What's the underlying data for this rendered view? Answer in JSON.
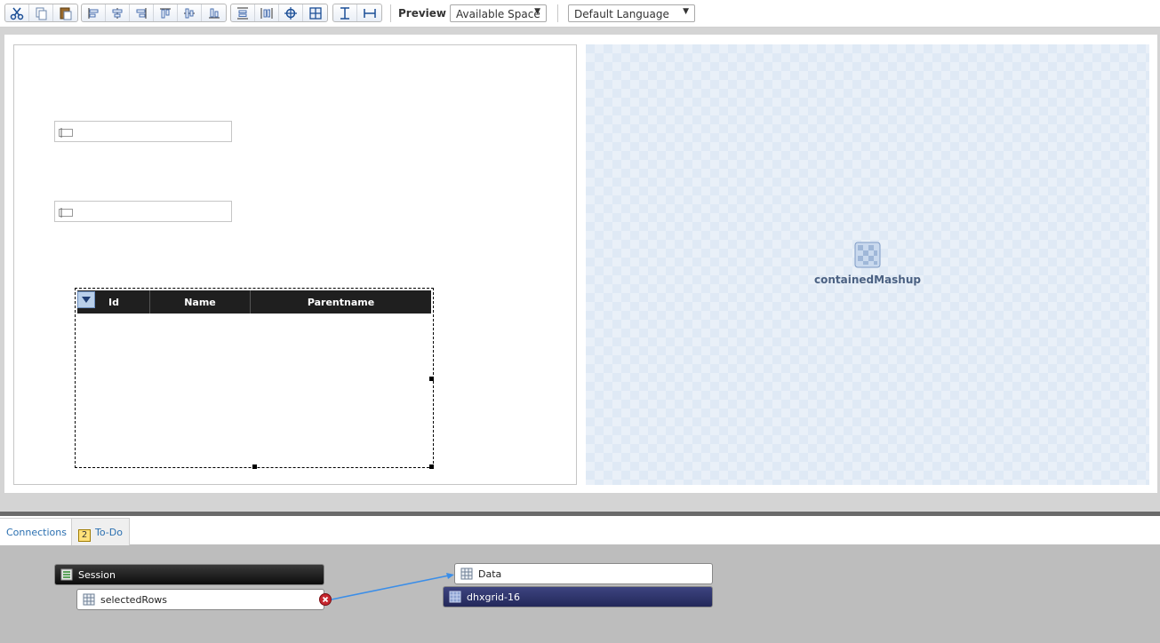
{
  "toolbar": {
    "buttons": [
      {
        "icon": "cut-icon"
      },
      {
        "icon": "copy-icon"
      },
      {
        "icon": "paste-icon"
      },
      {
        "icon": "align-left-icon"
      },
      {
        "icon": "align-center-icon"
      },
      {
        "icon": "align-right-icon"
      },
      {
        "icon": "align-top-icon"
      },
      {
        "icon": "align-middle-icon"
      },
      {
        "icon": "align-bottom-icon"
      },
      {
        "icon": "distribute-vertical-icon"
      },
      {
        "icon": "distribute-horizontal-icon"
      },
      {
        "icon": "center-icon"
      },
      {
        "icon": "grid-layout-icon"
      },
      {
        "icon": "same-height-icon"
      },
      {
        "icon": "same-width-icon"
      }
    ],
    "preview_label": "Preview",
    "space_select": "Available Space",
    "language_select": "Default Language"
  },
  "canvas": {
    "grid": {
      "columns": [
        "Id",
        "Name",
        "Parentname"
      ]
    },
    "contained": {
      "label": "containedMashup",
      "icon": "mashup-icon"
    }
  },
  "tabs": {
    "connections": "Connections",
    "todo_count": "2",
    "todo": "To-Do"
  },
  "connections": {
    "session_label": "Session",
    "selected_rows_label": "selectedRows",
    "data_label": "Data",
    "grid_label": "dhxgrid-16"
  },
  "colors": {
    "accent": "#2a6fb0",
    "wire": "#3b8ee8",
    "error": "#c6262e",
    "grid_node": "#2f3570"
  }
}
